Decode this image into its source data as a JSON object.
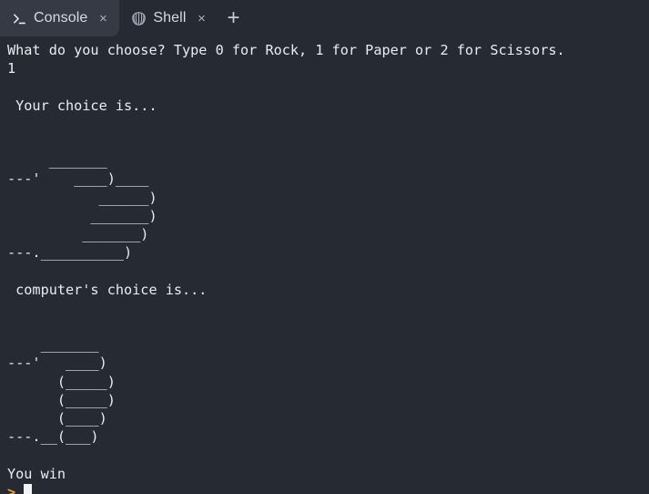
{
  "window": {
    "background_color": "#262a33",
    "active_tab_color": "#353a45",
    "text_color": "#e9ecf2",
    "prompt_color": "#e6a23c"
  },
  "tabbar": {
    "tabs": [
      {
        "label": "Console",
        "icon": "terminal-prompt-icon",
        "close_label": "×",
        "active": true
      },
      {
        "label": "Shell",
        "icon": "seashell-icon",
        "close_label": "×",
        "active": false
      }
    ],
    "add_tab_label": "+"
  },
  "console": {
    "output": "What do you choose? Type 0 for Rock, 1 for Paper or 2 for Scissors.\n1\n\n Your choice is...\n\n\n     _______\n---'    ____)____\n           ______)\n          _______)\n         _______)\n---.__________)\n\n computer's choice is...\n\n\n    _______\n---'   ____)\n      (_____)\n      (_____)\n      (____)\n---.__(___)\n\nYou win",
    "prompt_symbol": ">",
    "prompt_input_value": "",
    "cursor_visible": true
  }
}
